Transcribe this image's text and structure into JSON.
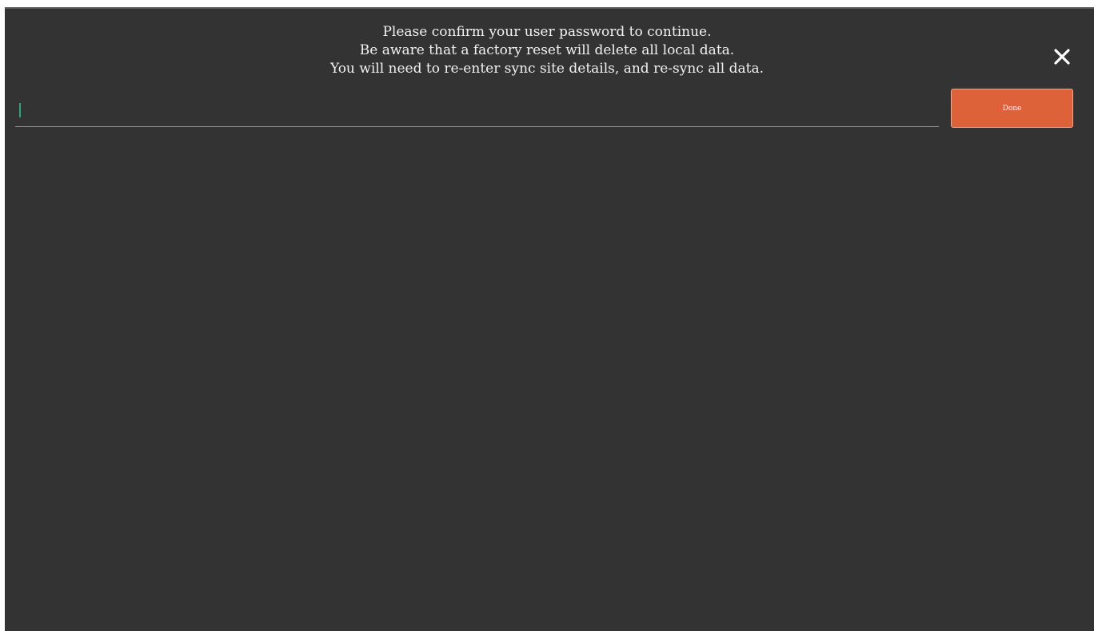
{
  "dialog": {
    "message_lines": [
      "Please confirm your user password to continue.",
      "Be aware that a factory reset will delete all local data.",
      "You will need to re-enter sync site details, and re-sync all data."
    ],
    "close_icon": "close-icon"
  },
  "password": {
    "value": "",
    "placeholder": ""
  },
  "actions": {
    "done_label": "Done"
  },
  "colors": {
    "background": "#333333",
    "accent": "#dd6239",
    "caret": "#2aa57c",
    "text": "#f2f2f2"
  }
}
